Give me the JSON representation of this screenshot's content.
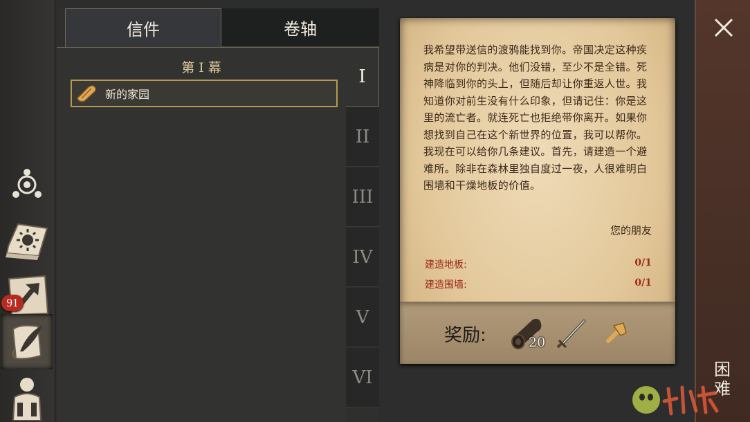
{
  "sidebar": {
    "items": [
      {
        "icon": "compass-icon"
      },
      {
        "icon": "sun-book-icon"
      },
      {
        "icon": "crafting-map-icon",
        "badge": "91"
      },
      {
        "icon": "quill-scroll-icon",
        "active": true
      },
      {
        "icon": "character-icon"
      }
    ]
  },
  "tabs": {
    "letters": "信件",
    "scrolls": "卷轴"
  },
  "quest_list": {
    "act_title": "第 I 幕",
    "items": [
      {
        "label": "新的家园",
        "icon": "scroll-icon"
      }
    ]
  },
  "chapters": [
    "I",
    "II",
    "III",
    "IV",
    "V",
    "VI"
  ],
  "letter": {
    "body": "我希望带送信的渡鸦能找到你。帝国决定这种疾病是对你的判决。他们没错，至少不是全错。死神降临到你的头上，但随后却让你重返人世。我知道你对前生没有什么印象，但请记住：你是这里的流亡者。就连死亡也拒绝带你离开。如果你想找到自己在这个新世界的位置，我可以帮你。我现在可以给你几条建议。首先，请建造一个避难所。除非在森林里独自度过一夜，人很难明白围墙和干燥地板的价值。",
    "signature": "您的朋友",
    "objectives": [
      {
        "label": "建造地板:",
        "value": "0/1"
      },
      {
        "label": "建造围墙:",
        "value": "0/1"
      }
    ],
    "reward_label": "奖励:",
    "rewards": [
      {
        "icon": "log-icon",
        "count": "20"
      },
      {
        "icon": "sword-icon"
      },
      {
        "icon": "hammer-icon"
      }
    ]
  },
  "right_panel": {
    "close_icon": "close-icon",
    "vertical_text": "困难"
  },
  "colors": {
    "accent_gold": "#b89a52",
    "objective_red": "#9c2a1a",
    "badge_red": "#b8291f"
  }
}
